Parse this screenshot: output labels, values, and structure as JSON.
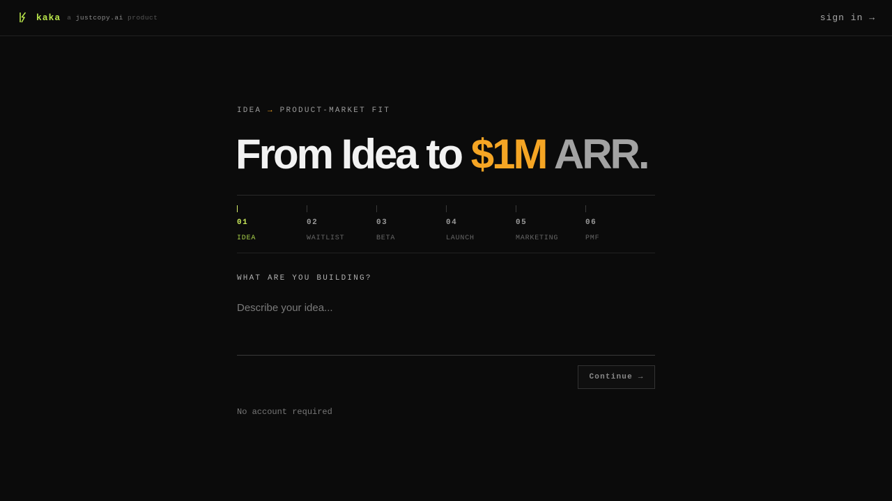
{
  "header": {
    "logo_icon": "k-bolt-logo-icon",
    "brand_name": "kaka",
    "tagline_prefix": "a",
    "tagline_company": "justcopy.ai",
    "tagline_suffix": "product",
    "sign_in_label": "sign in →"
  },
  "hero": {
    "eyebrow_start": "IDEA",
    "eyebrow_arrow": "→",
    "eyebrow_end": "PRODUCT-MARKET FIT",
    "headline_part1": "From Idea to ",
    "headline_accent": "$1M",
    "headline_part2": " ARR."
  },
  "steps": [
    {
      "num": "01",
      "label": "IDEA"
    },
    {
      "num": "02",
      "label": "WAITLIST"
    },
    {
      "num": "03",
      "label": "BETA"
    },
    {
      "num": "04",
      "label": "LAUNCH"
    },
    {
      "num": "05",
      "label": "MARKETING"
    },
    {
      "num": "06",
      "label": "PMF"
    }
  ],
  "form": {
    "prompt": "WHAT ARE YOU BUILDING?",
    "placeholder": "Describe your idea...",
    "value": "",
    "continue_label": "Continue →",
    "note": "No account required"
  },
  "colors": {
    "background": "#0b0b0b",
    "brand_green": "#b7e34a",
    "accent_orange": "#f5a524",
    "active_step": "#c8e85a"
  }
}
